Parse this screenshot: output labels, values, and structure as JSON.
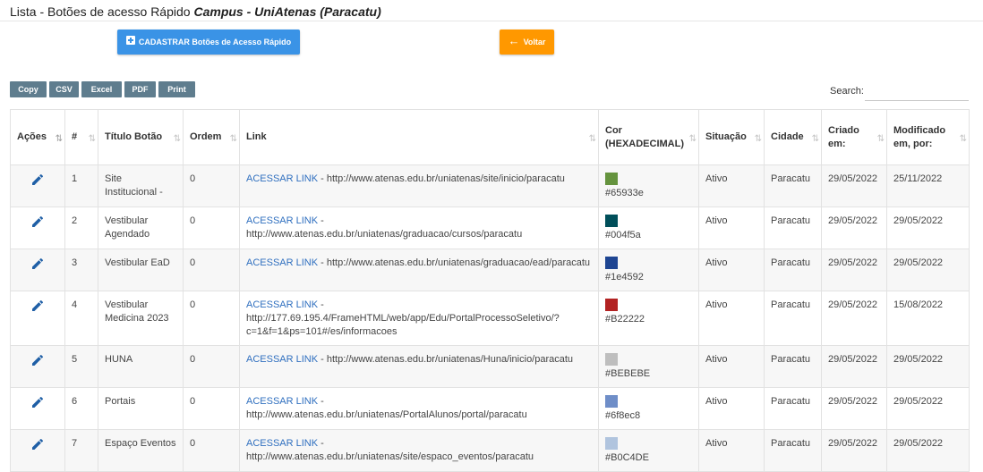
{
  "header": {
    "title_prefix": "Lista - Botões de acesso Rápido",
    "campus": "Campus - UniAtenas (Paracatu)"
  },
  "actions": {
    "add_label": "CADASTRAR Botões de Acesso Rápido",
    "back_label": "Voltar"
  },
  "export": {
    "buttons": [
      "Copy",
      "CSV",
      "Excel",
      "PDF",
      "Print"
    ]
  },
  "search": {
    "label": "Search:",
    "value": ""
  },
  "table": {
    "columns": [
      "Ações",
      "#",
      "Título Botão",
      "Ordem",
      "Link",
      "Cor (HEXADECIMAL)",
      "Situação",
      "Cidade",
      "Criado em:",
      "Modificado em, por:"
    ],
    "link_text": "ACESSAR LINK",
    "rows": [
      {
        "num": "1",
        "titulo": "Site Institucional -",
        "ordem": "0",
        "url": "http://www.atenas.edu.br/uniatenas/site/inicio/paracatu",
        "cor": "#65933e",
        "situacao": "Ativo",
        "cidade": "Paracatu",
        "criado": "29/05/2022",
        "modificado": "25/11/2022"
      },
      {
        "num": "2",
        "titulo": "Vestibular Agendado",
        "ordem": "0",
        "url": "http://www.atenas.edu.br/uniatenas/graduacao/cursos/paracatu",
        "cor": "#004f5a",
        "situacao": "Ativo",
        "cidade": "Paracatu",
        "criado": "29/05/2022",
        "modificado": "29/05/2022"
      },
      {
        "num": "3",
        "titulo": "Vestibular EaD",
        "ordem": "0",
        "url": "http://www.atenas.edu.br/uniatenas/graduacao/ead/paracatu",
        "cor": "#1e4592",
        "situacao": "Ativo",
        "cidade": "Paracatu",
        "criado": "29/05/2022",
        "modificado": "29/05/2022"
      },
      {
        "num": "4",
        "titulo": "Vestibular Medicina 2023",
        "ordem": "0",
        "url": "http://177.69.195.4/FrameHTML/web/app/Edu/PortalProcessoSeletivo/?c=1&f=1&ps=101#/es/informacoes",
        "cor": "#B22222",
        "situacao": "Ativo",
        "cidade": "Paracatu",
        "criado": "29/05/2022",
        "modificado": "15/08/2022"
      },
      {
        "num": "5",
        "titulo": "HUNA",
        "ordem": "0",
        "url": "http://www.atenas.edu.br/uniatenas/Huna/inicio/paracatu",
        "cor": "#BEBEBE",
        "situacao": "Ativo",
        "cidade": "Paracatu",
        "criado": "29/05/2022",
        "modificado": "29/05/2022"
      },
      {
        "num": "6",
        "titulo": "Portais",
        "ordem": "0",
        "url": "http://www.atenas.edu.br/uniatenas/PortalAlunos/portal/paracatu",
        "cor": "#6f8ec8",
        "situacao": "Ativo",
        "cidade": "Paracatu",
        "criado": "29/05/2022",
        "modificado": "29/05/2022"
      },
      {
        "num": "7",
        "titulo": "Espaço Eventos",
        "ordem": "0",
        "url": "http://www.atenas.edu.br/uniatenas/site/espaco_eventos/paracatu",
        "cor": "#B0C4DE",
        "situacao": "Ativo",
        "cidade": "Paracatu",
        "criado": "29/05/2022",
        "modificado": "29/05/2022"
      }
    ]
  },
  "icons": {
    "edit": "pencil-icon",
    "plus": "plus-square-icon",
    "back": "arrow-left-icon",
    "sort": "sort-icon"
  },
  "colors": {
    "primary_button": "#3a93e6",
    "back_button": "#ff9800",
    "export_button": "#5f7d8e",
    "link": "#2f6fbf",
    "edit_icon": "#1f5fa6"
  }
}
